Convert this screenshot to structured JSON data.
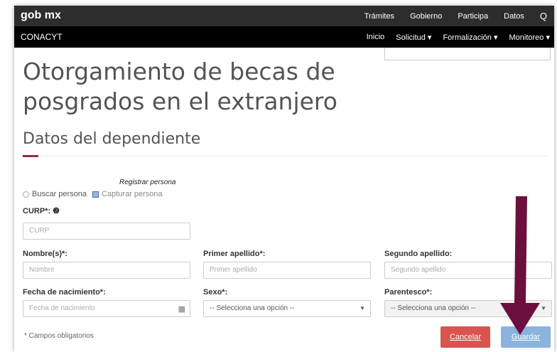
{
  "topbar": {
    "brand": "gob mx",
    "links": [
      "Trámites",
      "Gobierno",
      "Participa",
      "Datos"
    ],
    "search_icon": "Q"
  },
  "subbar": {
    "brand": "CONACYT",
    "links": [
      "Inicio",
      "Solicitud ▾",
      "Formalización ▾",
      "Monitoreo ▾"
    ]
  },
  "page": {
    "title_line1": "Otorgamiento de becas de",
    "title_line2": "posgrados en el extranjero",
    "section": "Datos del dependiente"
  },
  "tooltip": "Registrar persona",
  "radios": {
    "option1": "Buscar persona",
    "option2": "Capturar persona"
  },
  "fields": {
    "curp": {
      "label": "CURP*:",
      "placeholder": "CURP"
    },
    "nombre": {
      "label": "Nombre(s)*:",
      "placeholder": "Nombre"
    },
    "primer_apellido": {
      "label": "Primer apellido*:",
      "placeholder": "Primer apellido"
    },
    "segundo_apellido": {
      "label": "Segundo apellido:",
      "placeholder": "Segundo apellido"
    },
    "fecha": {
      "label": "Fecha de nacimiento*:",
      "placeholder": "Fecha de nacimiento"
    },
    "sexo": {
      "label": "Sexo*:",
      "value": "-- Selecciona una opción --"
    },
    "parentesco": {
      "label": "Parentesco*:",
      "value": "-- Selecciona una opción --"
    }
  },
  "note": "* Campos obligatorios",
  "buttons": {
    "cancel": "Cancelar",
    "save": "Guardar"
  },
  "colors": {
    "brand_red": "#9d2449",
    "arrow": "#6b0f3f",
    "cancel": "#d9534f",
    "save": "#8ab3de"
  }
}
